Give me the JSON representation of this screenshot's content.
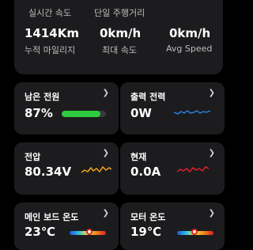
{
  "stats": {
    "realtime_speed_label": "실시간 속도",
    "single_trip_label": "단일 주행거리",
    "total_mileage_value": "1414Km",
    "total_mileage_label": "누적 마일리지",
    "max_speed_value": "0km/h",
    "max_speed_label": "최대 속도",
    "avg_speed_value": "0km/h",
    "avg_speed_label": "Avg Speed"
  },
  "cards": {
    "battery": {
      "title": "남은 전원",
      "value": "87%",
      "level": 0.87,
      "bar_color": "#2ecc40"
    },
    "output_power": {
      "title": "출력 전력",
      "value": "0W",
      "wave_color": "#2e7dd6"
    },
    "voltage": {
      "title": "전압",
      "value": "80.34V",
      "wave_color": "#f0a020"
    },
    "current": {
      "title": "현재",
      "value": "0.0A",
      "wave_color": "#e02030"
    },
    "mainboard_temp": {
      "title": "메인 보드 온도",
      "value": "23℃"
    },
    "motor_temp": {
      "title": "모터 온도",
      "value": "19℃"
    }
  },
  "chevron_icon": "chevron-right-icon"
}
